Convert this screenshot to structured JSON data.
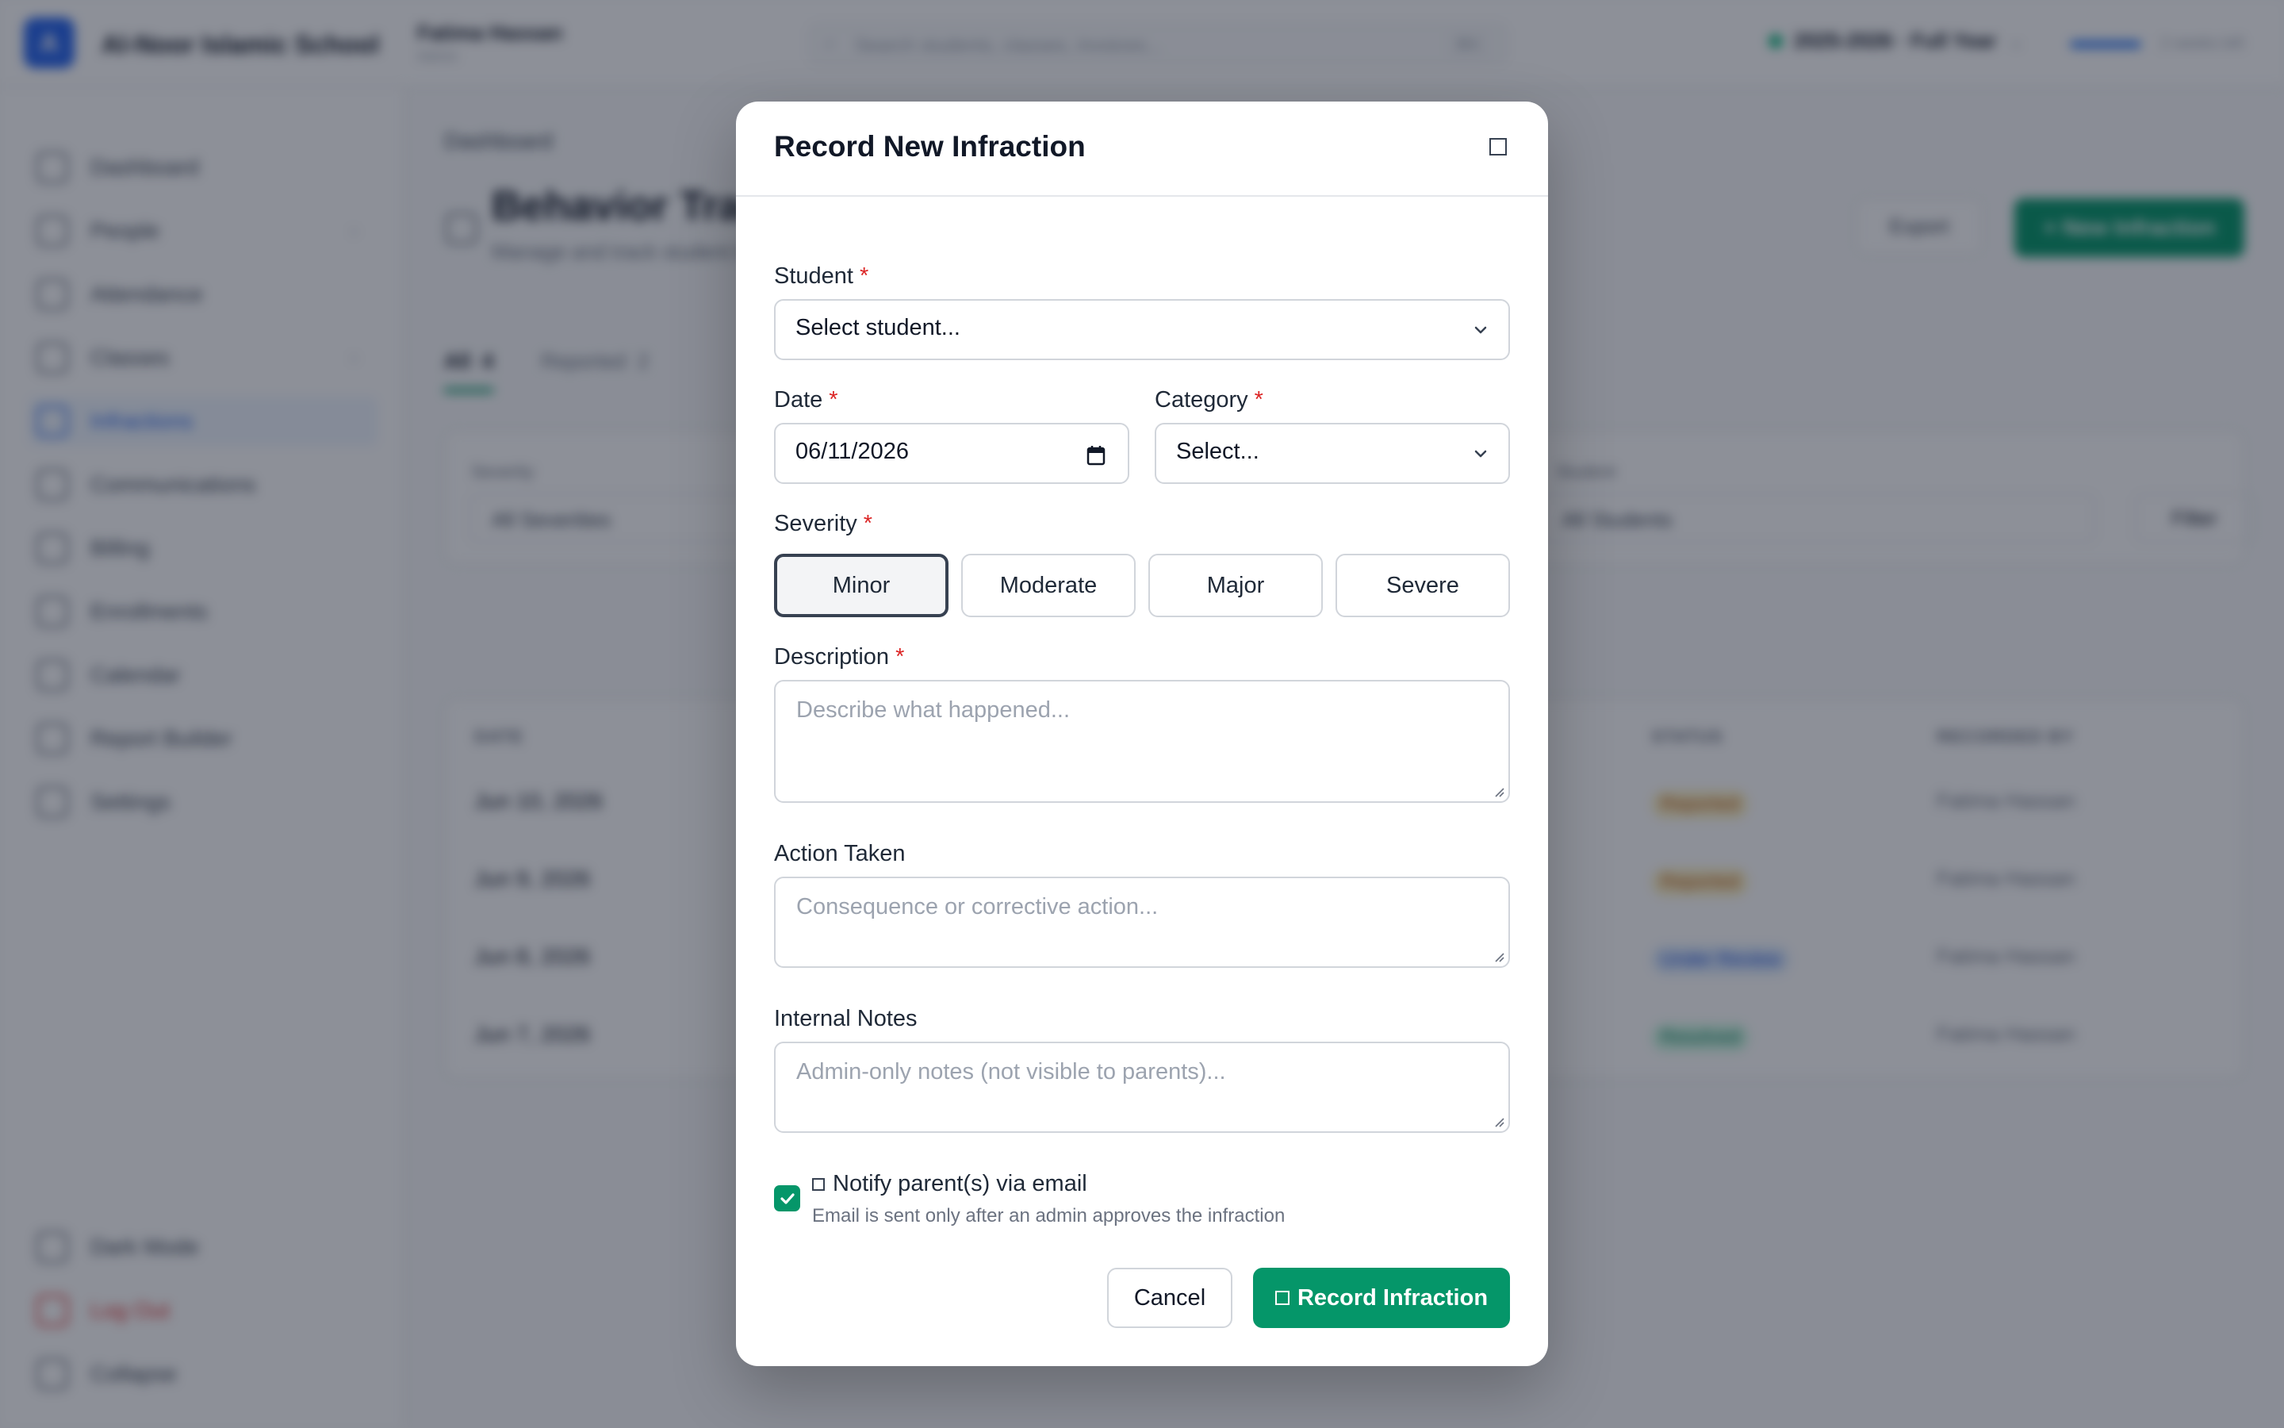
{
  "app": {
    "logo_letter": "A",
    "school_name": "Al-Noor Islamic School",
    "user_name": "Fatima Hassan",
    "user_role": "Admin",
    "search_placeholder": "Search students, classes, invoices...",
    "search_shortcut": "⌘K",
    "term": "2025-2026 · Full Year",
    "saved_text": "2 weeks left"
  },
  "sidebar": {
    "items": [
      {
        "label": "Dashboard"
      },
      {
        "label": "People"
      },
      {
        "label": "Attendance"
      },
      {
        "label": "Classes"
      },
      {
        "label": "Infractions"
      },
      {
        "label": "Communications"
      },
      {
        "label": "Billing"
      },
      {
        "label": "Enrollments"
      },
      {
        "label": "Calendar"
      },
      {
        "label": "Report Builder"
      },
      {
        "label": "Settings"
      }
    ],
    "bottom": [
      {
        "label": "Dark Mode"
      },
      {
        "label": "Log Out"
      },
      {
        "label": "Collapse"
      }
    ]
  },
  "main": {
    "breadcrumb": "Dashboard",
    "title": "Behavior Tracking",
    "subtitle": "Manage and track student behavior",
    "export_label": "Export",
    "new_label": "+ New Infraction",
    "tabs": [
      {
        "label": "All",
        "count": "4"
      },
      {
        "label": "Reported",
        "count": "2"
      }
    ],
    "filters": {
      "severity_label": "Severity",
      "severity_value": "All Severities",
      "student_label": "Student",
      "student_value": "All Students",
      "filter_button": "Filter"
    },
    "table": {
      "headers": [
        "DATE",
        "STATUS",
        "RECORDED BY"
      ],
      "rows": [
        {
          "date": "Jun 10, 2026",
          "status": "Reported",
          "by": "Fatima Hassan"
        },
        {
          "date": "Jun 9, 2026",
          "status": "Reported",
          "by": "Fatima Hassan"
        },
        {
          "date": "Jun 8, 2026",
          "status": "Under Review",
          "by": "Fatima Hassan"
        },
        {
          "date": "Jun 7, 2026",
          "status": "Resolved",
          "by": "Fatima Hassan"
        }
      ]
    }
  },
  "modal": {
    "title": "Record New Infraction",
    "student_label": "Student",
    "student_value": "Select student...",
    "date_label": "Date",
    "date_value": "06/11/2026",
    "category_label": "Category",
    "category_value": "Select...",
    "severity_label": "Severity",
    "severity_options": [
      "Minor",
      "Moderate",
      "Major",
      "Severe"
    ],
    "severity_selected": "Minor",
    "description_label": "Description",
    "description_placeholder": "Describe what happened...",
    "action_label": "Action Taken",
    "action_placeholder": "Consequence or corrective action...",
    "notes_label": "Internal Notes",
    "notes_placeholder": "Admin-only notes (not visible to parents)...",
    "notify_label": "Notify parent(s) via email",
    "notify_checked": true,
    "notify_help": "Email is sent only after an admin approves the infraction",
    "required_mark": "*",
    "cancel_label": "Cancel",
    "submit_label": "Record Infraction"
  },
  "colors": {
    "primary_green": "#059669",
    "required_red": "#dc2626",
    "brand_blue": "#2563eb"
  }
}
